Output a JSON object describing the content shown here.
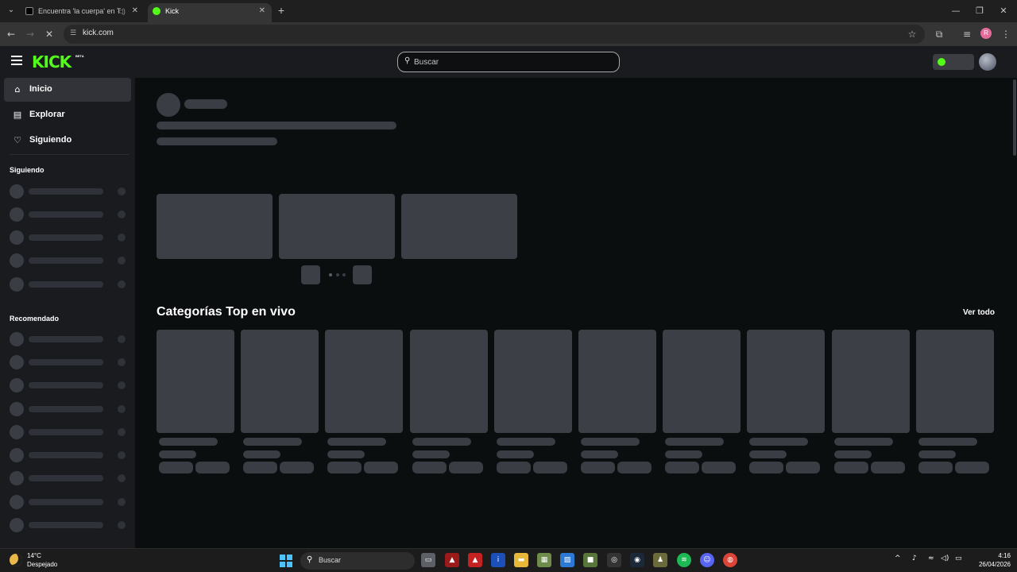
{
  "browser": {
    "tabs": [
      {
        "title": "Encuentra 'la cuerpa' en Ti",
        "active": false
      },
      {
        "title": "Kick",
        "active": true
      }
    ],
    "url": "kick.com",
    "profile_initial": "R"
  },
  "site": {
    "search_placeholder": "Buscar",
    "brand_color": "#53fc18",
    "nav": [
      {
        "label": "Inicio",
        "icon": "home-icon",
        "active": true
      },
      {
        "label": "Explorar",
        "icon": "explore-icon",
        "active": false
      },
      {
        "label": "Siguiendo",
        "icon": "heart-icon",
        "active": false
      }
    ],
    "sidebar_following_heading": "Siguiendo",
    "sidebar_recommended_heading": "Recomendado",
    "categories_heading": "Categorías Top en vivo",
    "see_all_label": "Ver todo"
  },
  "taskbar": {
    "temperature": "14°C",
    "weather": "Despejado",
    "search_label": "Buscar",
    "time": "4:16",
    "date": "26/04/2026"
  }
}
